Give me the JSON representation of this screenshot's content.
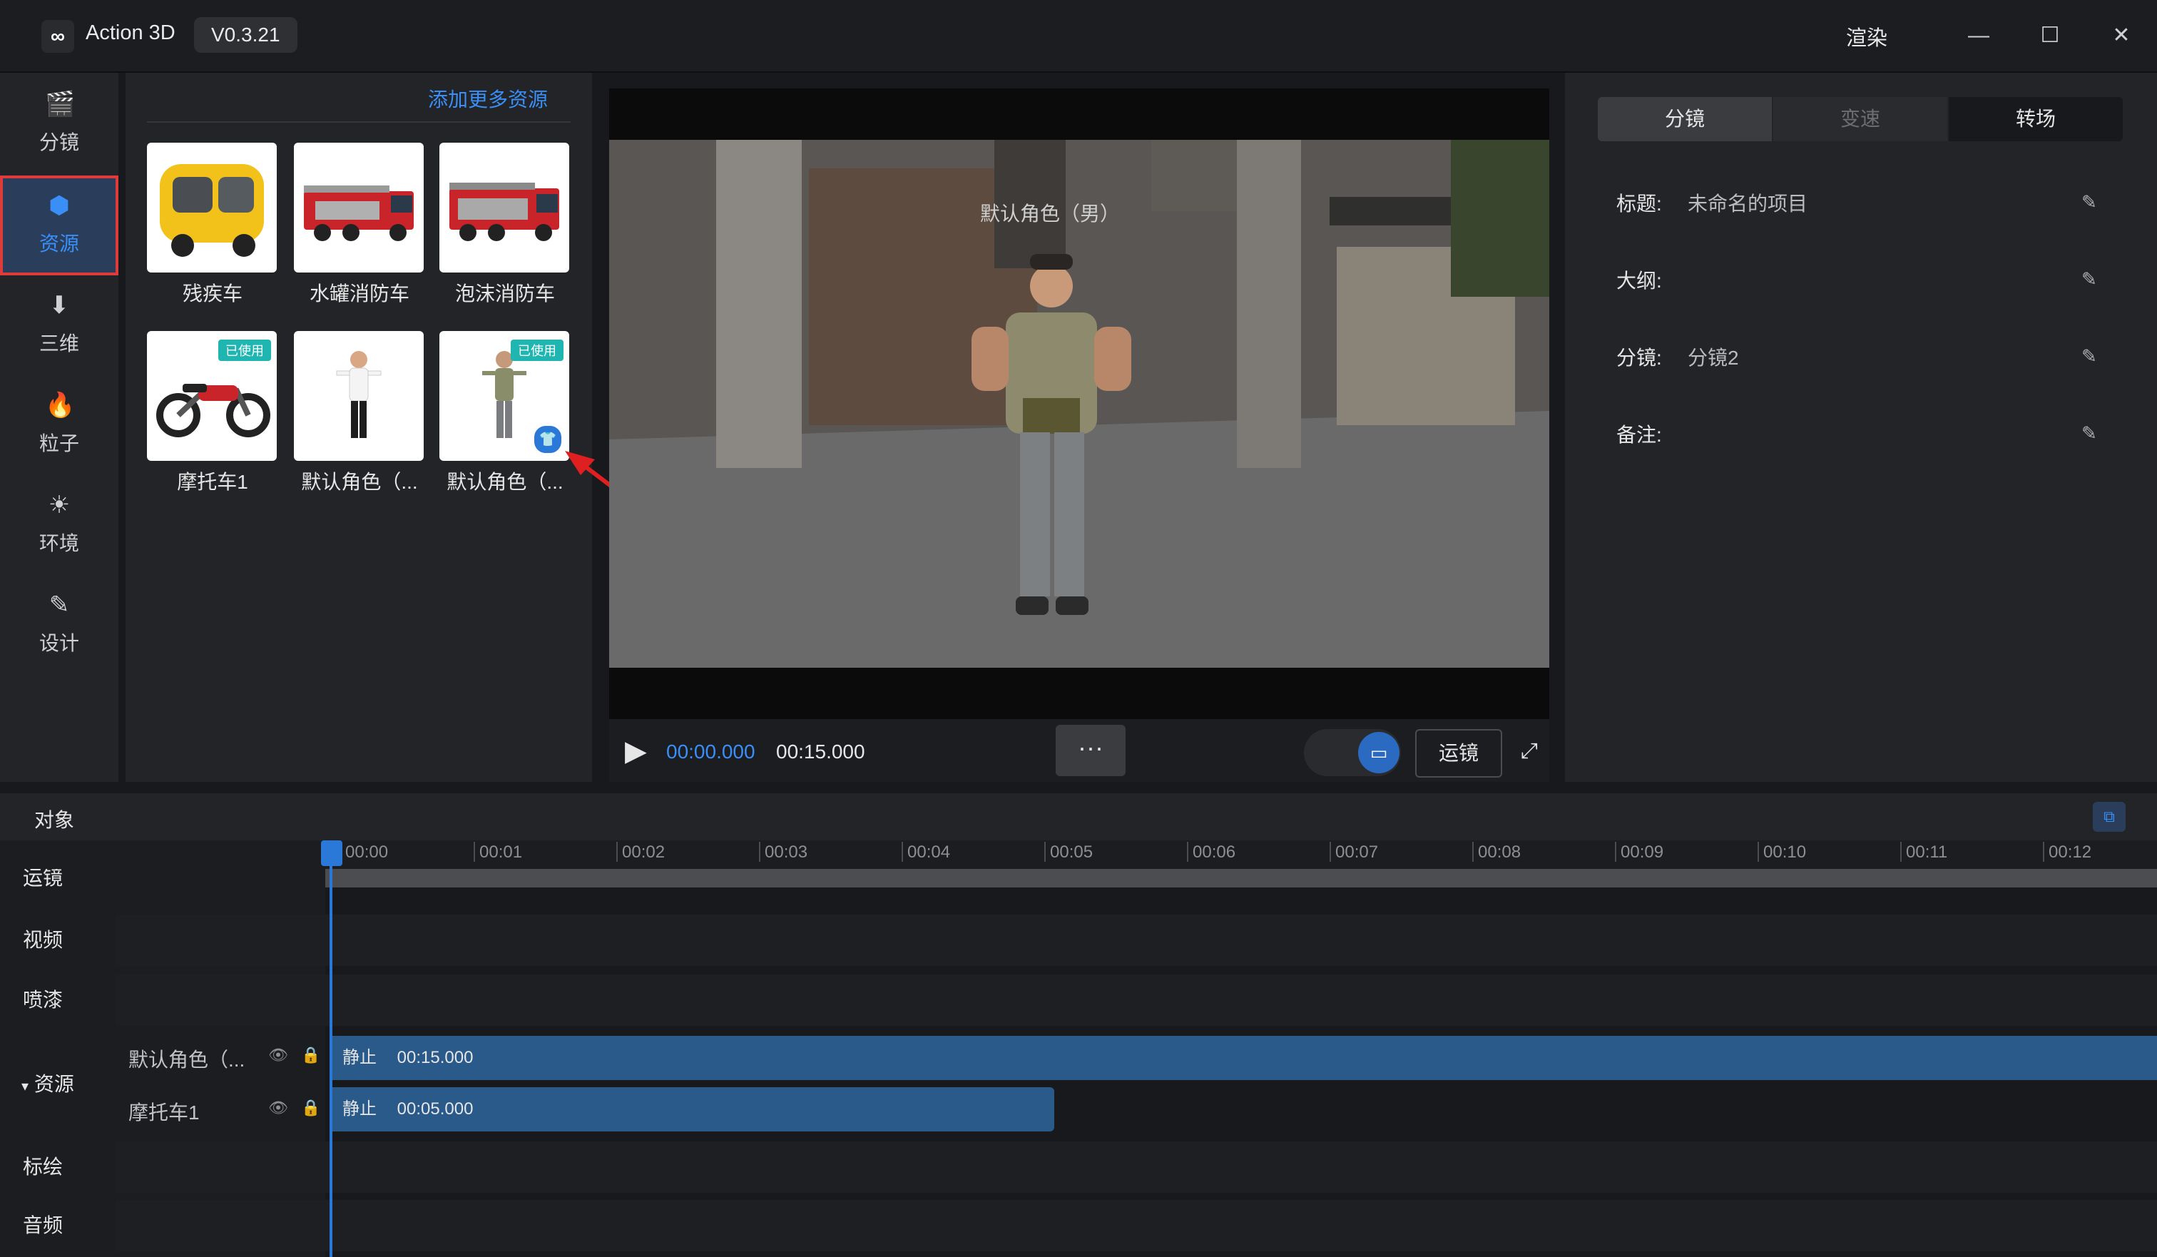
{
  "app": {
    "title": "Action 3D",
    "version": "V0.3.21",
    "logo": "∞"
  },
  "titlebar": {
    "render": "渲染",
    "minimize": "—",
    "maximize": "☐",
    "close": "✕"
  },
  "nav": [
    {
      "label": "分镜",
      "icon": "clapperboard-icon",
      "glyph": "🎬"
    },
    {
      "label": "资源",
      "icon": "cube-icon",
      "glyph": "⬢"
    },
    {
      "label": "三维",
      "icon": "download-box-icon",
      "glyph": "⬇"
    },
    {
      "label": "粒子",
      "icon": "flame-icon",
      "glyph": "🔥"
    },
    {
      "label": "环境",
      "icon": "sun-icon",
      "glyph": "☀"
    },
    {
      "label": "设计",
      "icon": "design-tools-icon",
      "glyph": "✎"
    }
  ],
  "resources": {
    "add_more": "添加更多资源",
    "items": [
      {
        "label": "残疾车",
        "used": false,
        "used_text": ""
      },
      {
        "label": "水罐消防车",
        "used": false,
        "used_text": ""
      },
      {
        "label": "泡沫消防车",
        "used": false,
        "used_text": ""
      },
      {
        "label": "摩托车1",
        "used": true,
        "used_text": "已使用"
      },
      {
        "label": "默认角色（...",
        "used": false,
        "used_text": ""
      },
      {
        "label": "默认角色（...",
        "used": true,
        "used_text": "已使用"
      }
    ]
  },
  "preview": {
    "overlay_label": "默认角色（男）",
    "time_current": "00:00.000",
    "time_total": "00:15.000",
    "more": "···",
    "camera_move": "运镜",
    "fullscreen": "⤢",
    "play": "▶"
  },
  "right_panel": {
    "tabs": [
      "分镜",
      "变速",
      "转场"
    ],
    "fields": [
      {
        "label": "标题:",
        "value": "未命名的项目"
      },
      {
        "label": "大纲:",
        "value": ""
      },
      {
        "label": "分镜:",
        "value": "分镜2"
      },
      {
        "label": "备注:",
        "value": ""
      }
    ],
    "edit_glyph": "✎"
  },
  "timeline": {
    "title": "对象",
    "ticks": [
      "00:00",
      "00:01",
      "00:02",
      "00:03",
      "00:04",
      "00:05",
      "00:06",
      "00:07",
      "00:08",
      "00:09",
      "00:10",
      "00:11",
      "00:12"
    ],
    "tracks": {
      "hidden_label": "运镜",
      "video": "视频",
      "spray": "喷漆",
      "resources": "资源",
      "drawing": "标绘",
      "audio": "音频"
    },
    "resource_rows": [
      {
        "name": "默认角色（...",
        "clip_state": "静止",
        "clip_duration": "00:15.000"
      },
      {
        "name": "摩托车1",
        "clip_state": "静止",
        "clip_duration": "00:05.000"
      }
    ],
    "eye": "👁",
    "lock": "🔒"
  }
}
